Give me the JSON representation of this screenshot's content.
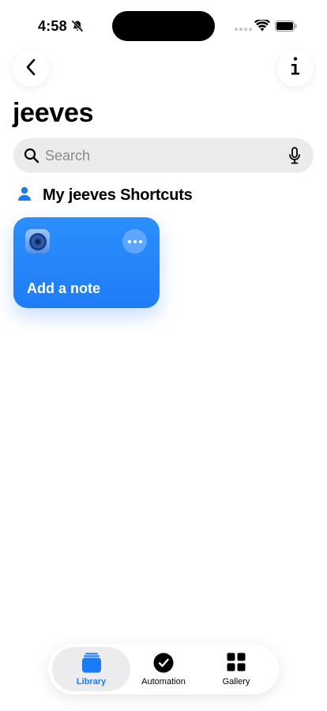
{
  "status_bar": {
    "time": "4:58"
  },
  "header": {
    "title": "jeeves"
  },
  "search": {
    "placeholder": "Search"
  },
  "section": {
    "title": "My jeeves Shortcuts"
  },
  "shortcuts": [
    {
      "title": "Add a note",
      "color": "#2387f9"
    }
  ],
  "tab_bar": {
    "selected": "Library",
    "tabs": [
      {
        "label": "Library",
        "icon": "stacked-squares-icon"
      },
      {
        "label": "Automation",
        "icon": "clock-check-icon"
      },
      {
        "label": "Gallery",
        "icon": "grid-icon"
      }
    ]
  },
  "colors": {
    "accent": "#1a7cf5",
    "search_bg": "#ebebed"
  }
}
